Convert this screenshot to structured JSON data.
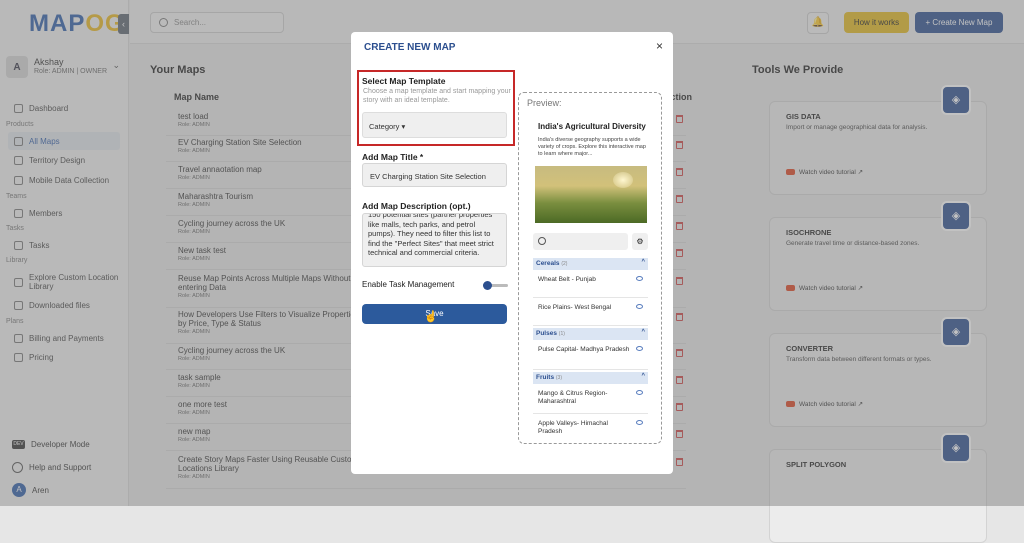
{
  "app": {
    "logo_a": "MAP",
    "logo_b": "OG"
  },
  "user": {
    "initial": "A",
    "name": "Akshay",
    "role": "Role: ADMIN | OWNER"
  },
  "nav": {
    "dashboard": "Dashboard",
    "sec_products": "Products",
    "all_maps": "All Maps",
    "territory": "Territory Design",
    "mobile": "Mobile Data Collection",
    "sec_teams": "Teams",
    "members": "Members",
    "sec_tasks": "Tasks",
    "tasks": "Tasks",
    "sec_library": "Library",
    "explore": "Explore Custom Location Library",
    "downloaded": "Downloaded files",
    "sec_plans": "Plans",
    "billing": "Billing and Payments",
    "pricing": "Pricing",
    "developer": "Developer Mode",
    "dev_badge": "DEV",
    "help": "Help and Support",
    "bottom_user_initial": "A",
    "bottom_user": "Aren"
  },
  "topbar": {
    "search_placeholder": "Search...",
    "how_it_works": "How it works",
    "create_new_map": "+ Create New Map"
  },
  "maps": {
    "heading": "Your Maps",
    "col_name": "Map Name",
    "col_action": "Action",
    "rows": [
      {
        "name": "test load",
        "role": "Role: ADMIN"
      },
      {
        "name": "EV Charging Station Site Selection",
        "role": "Role: ADMIN"
      },
      {
        "name": "Travel annaotation map",
        "role": "Role: ADMIN"
      },
      {
        "name": "Maharashtra Tourism",
        "role": "Role: ADMIN"
      },
      {
        "name": "Cycling journey across the UK",
        "role": "Role: ADMIN"
      },
      {
        "name": "New task test",
        "role": "Role: ADMIN"
      },
      {
        "name": "Reuse Map Points Across Multiple Maps Without Re-entering Data",
        "role": "Role: ADMIN"
      },
      {
        "name": "How Developers Use Filters to Visualize Properties by Price, Type & Status",
        "role": "Role: ADMIN"
      },
      {
        "name": "Cycling journey across the UK",
        "role": "Role: ADMIN"
      },
      {
        "name": "task sample",
        "role": "Role: ADMIN"
      },
      {
        "name": "one more test",
        "role": "Role: ADMIN"
      },
      {
        "name": "new map",
        "role": "Role: ADMIN"
      },
      {
        "name": "Create Story Maps Faster Using Reusable Custom Locations Library",
        "role": "Role: ADMIN"
      }
    ]
  },
  "tools": {
    "heading": "Tools We Provide",
    "watch": "Watch video tutorial ↗",
    "items": [
      {
        "title": "GIS DATA",
        "desc": "Import or manage geographical data for analysis.",
        "icon": "database-icon"
      },
      {
        "title": "ISOCHRONE",
        "desc": "Generate travel time or distance-based zones.",
        "icon": "radar-icon"
      },
      {
        "title": "CONVERTER",
        "desc": "Transform data between different formats or types.",
        "icon": "converter-icon"
      },
      {
        "title": "SPLIT POLYGON",
        "desc": "",
        "icon": "polygon-icon"
      }
    ]
  },
  "modal": {
    "title": "CREATE NEW MAP",
    "close": "×",
    "template_label": "Select Map Template",
    "template_hint": "Choose a map template and start mapping your story with an ideal template.",
    "category": "Category ▾",
    "title_label": "Add Map Title *",
    "title_value": "EV Charging Station Site Selection",
    "desc_label": "Add Map Description (opt.)",
    "desc_value": "150 potential sites (partner properties like malls, tech parks, and petrol pumps). They need to filter this list to find the \"Perfect Sites\" that meet strict technical and commercial criteria.",
    "task_label": "Enable Task Management",
    "task_enabled": false,
    "save": "Save"
  },
  "preview": {
    "label": "Preview:",
    "card_title": "India's Agricultural Diversity",
    "card_desc": "India's diverse geography supports a wide variety of crops. Explore this interactive map to learn where major...",
    "groups": [
      {
        "name": "Cereals",
        "count": "(2)",
        "items": [
          "Wheat Belt - Punjab",
          "Rice Plains- West Bengal"
        ]
      },
      {
        "name": "Pulses",
        "count": "(1)",
        "items": [
          "Pulse Capital- Madhya Pradesh"
        ]
      },
      {
        "name": "Fruits",
        "count": "(3)",
        "items": [
          "Mango & Citrus Region- Maharashtral",
          "Apple Valleys- Himachal Pradesh"
        ]
      }
    ]
  }
}
